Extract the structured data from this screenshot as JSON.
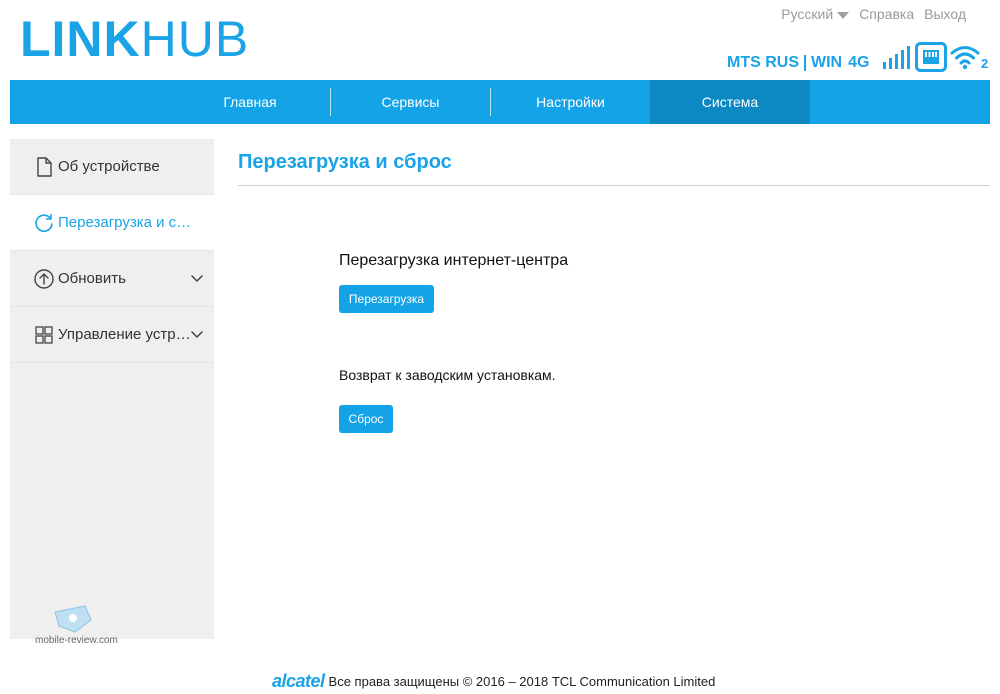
{
  "header": {
    "logo_bold": "LINK",
    "logo_light": "HUB",
    "language": "Русский",
    "help": "Справка",
    "logout": "Выход",
    "operator": "MTS RUS",
    "network_name": "WIN",
    "network_type": "4G",
    "wifi_clients": "2"
  },
  "nav": {
    "items": [
      {
        "label": "Главная"
      },
      {
        "label": "Сервисы"
      },
      {
        "label": "Настройки"
      },
      {
        "label": "Система"
      }
    ],
    "active": "Система"
  },
  "sidebar": {
    "items": [
      {
        "label": "Об устройстве",
        "icon": "document-icon"
      },
      {
        "label": "Перезагрузка и сб...",
        "icon": "refresh-icon"
      },
      {
        "label": "Обновить",
        "icon": "upload-icon"
      },
      {
        "label": "Управление устро...",
        "icon": "grid-icon"
      }
    ],
    "active_index": 1
  },
  "watermark": "mobile-review.com",
  "main": {
    "title": "Перезагрузка и сброс",
    "reboot_heading": "Перезагрузка интернет-центра",
    "reboot_button": "Перезагрузка",
    "reset_heading": "Возврат к заводским установкам.",
    "reset_button": "Сброс"
  },
  "footer": {
    "brand": "alcatel",
    "copyright": "Все права защищены © 2016 – 2018 TCL Communication Limited"
  },
  "colors": {
    "accent": "#13a3e6",
    "nav_active": "#0c88c2",
    "sidebar_bg": "#efefef"
  }
}
